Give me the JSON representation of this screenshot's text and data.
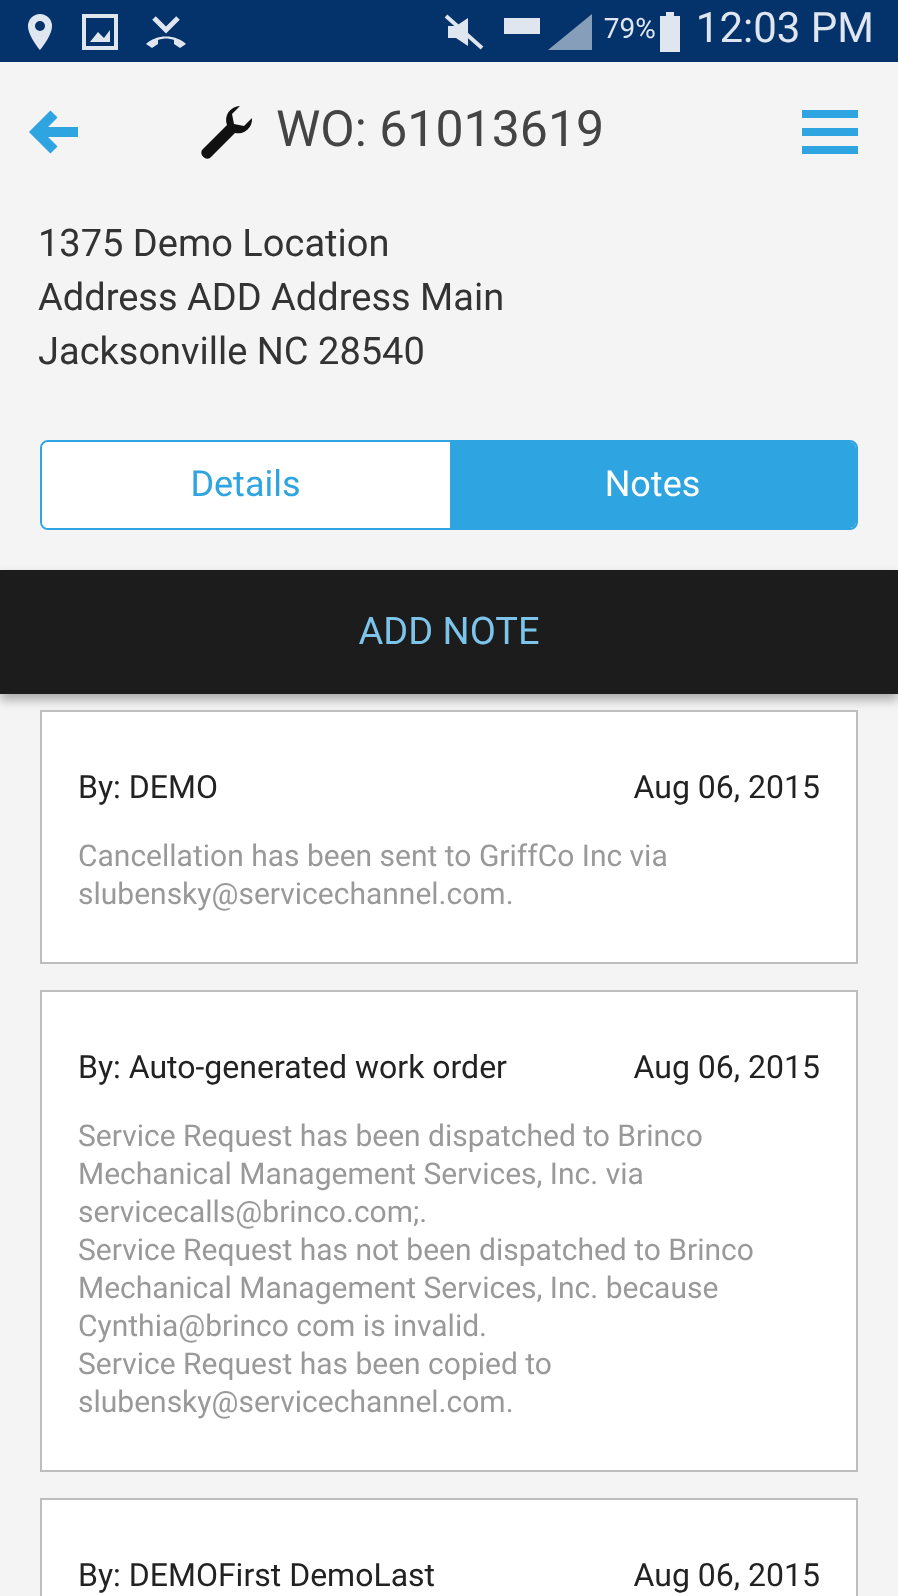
{
  "status_bar": {
    "battery": "79%",
    "time": "12:03 PM"
  },
  "header": {
    "title": "WO: 61013619"
  },
  "address": [
    "1375 Demo Location",
    "Address ADD Address Main",
    "Jacksonville NC 28540"
  ],
  "tabs": [
    {
      "label": "Details",
      "selected": false
    },
    {
      "label": "Notes",
      "selected": true
    }
  ],
  "add_note": "ADD NOTE",
  "notes": [
    {
      "author": "By: DEMO",
      "date": "Aug 06, 2015",
      "lines": [
        "Cancellation has been sent to GriffCo Inc via",
        "slubensky@servicechannel.com."
      ]
    },
    {
      "author": "By: Auto-generated work order",
      "date": "Aug 06, 2015",
      "lines": [
        "Service Request has been dispatched to Brinco",
        "Mechanical Management Services, Inc. via",
        "servicecalls@brinco.com;.",
        "Service Request has not been dispatched to Brinco",
        "Mechanical Management Services, Inc. because",
        "Cynthia@brinco com is invalid.",
        "Service Request has been copied to",
        "slubensky@servicechannel.com."
      ]
    },
    {
      "author": "By: DEMOFirst DemoLast",
      "date": "Aug 06, 2015"
    }
  ]
}
